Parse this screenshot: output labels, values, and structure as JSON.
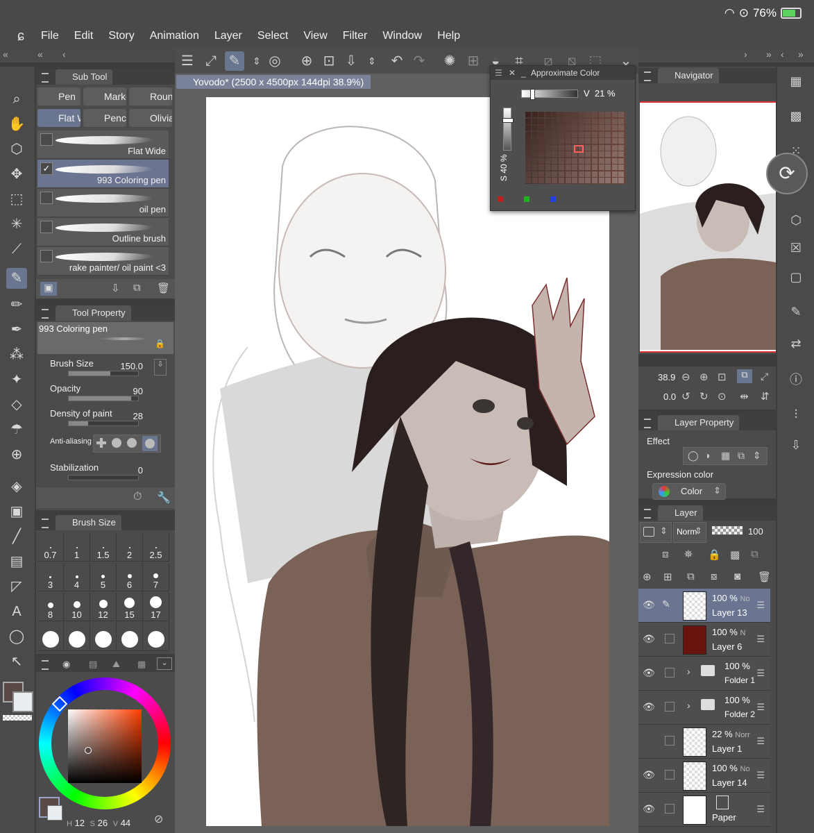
{
  "status": {
    "battery": "76%"
  },
  "menu": [
    "File",
    "Edit",
    "Story",
    "Animation",
    "Layer",
    "Select",
    "View",
    "Filter",
    "Window",
    "Help"
  ],
  "sub_tool": {
    "title": "Sub Tool",
    "groups": [
      "Pen",
      "Marker",
      "Round",
      "Flat Wide",
      "Pencil",
      "Olivia"
    ],
    "brushes": [
      "Flat Wide",
      "993 Coloring pen",
      "oil pen",
      "Outline brush",
      "rake painter/ oil paint <3"
    ]
  },
  "tool_property": {
    "title": "Tool Property",
    "brush_name": "993 Coloring pen",
    "brush_size_label": "Brush Size",
    "brush_size": "150.0",
    "opacity_label": "Opacity",
    "opacity": "90",
    "density_label": "Density of paint",
    "density": "28",
    "antialias_label": "Anti-aliasing",
    "stabilization_label": "Stabilization",
    "stabilization": "0",
    "brush_size_pct": 0.6,
    "opacity_pct": 0.9,
    "density_pct": 0.28,
    "stabilization_pct": 0.0
  },
  "brush_size_panel": {
    "title": "Brush Size",
    "sizes": [
      "0.7",
      "1",
      "1.5",
      "2",
      "2.5",
      "3",
      "4",
      "5",
      "6",
      "7",
      "8",
      "10",
      "12",
      "15",
      "17"
    ]
  },
  "color_panel": {
    "h_label": "H",
    "h": "12",
    "s_label": "S",
    "s": "26",
    "v_label": "V",
    "v": "44",
    "main_color": "#5a4a47",
    "sub_color": "#e8eef2"
  },
  "document": {
    "tab": "Yovodo* (2500 x 4500px 144dpi 38.9%)"
  },
  "approx_color": {
    "title": "Approximate Color",
    "v_label": "V",
    "v": "21 %",
    "s_label": "S",
    "s": "40 %"
  },
  "navigator": {
    "title": "Navigator",
    "zoom": "38.9",
    "rotation": "0.0"
  },
  "layer_property": {
    "title": "Layer Property",
    "effect_label": "Effect",
    "expression_label": "Expression color",
    "expression_value": "Color"
  },
  "layer_panel": {
    "title": "Layer",
    "blend": "Norm",
    "opacity": "100",
    "layers": [
      {
        "pct": "100 %",
        "mode": "No",
        "name": "Layer 13",
        "active": true
      },
      {
        "pct": "100 %",
        "mode": "N",
        "name": "Layer 6",
        "active": false
      },
      {
        "pct": "100 %",
        "mode": "",
        "name": "Folder 1",
        "active": false
      },
      {
        "pct": "100 %",
        "mode": "",
        "name": "Folder 2",
        "active": false
      },
      {
        "pct": "22 %",
        "mode": "Norr",
        "name": "Layer 1",
        "active": false
      },
      {
        "pct": "100 %",
        "mode": "No",
        "name": "Layer 14",
        "active": false
      },
      {
        "pct": "",
        "mode": "",
        "name": "Paper",
        "active": false
      }
    ]
  }
}
